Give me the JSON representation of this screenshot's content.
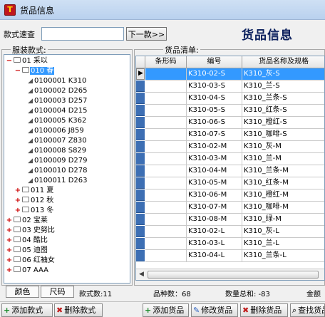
{
  "window": {
    "title": "货品信息",
    "icon": "app-logo-icon"
  },
  "search": {
    "label": "款式速查",
    "value": "",
    "next_label": "下一款>>"
  },
  "header": {
    "title": "货品信息"
  },
  "tree_panel": {
    "legend": "服装款式:"
  },
  "grid_panel": {
    "legend": "货品清单:"
  },
  "tree": [
    {
      "label": "01 采以",
      "expander": "−",
      "kind": "folder",
      "level": 0,
      "selected": false
    },
    {
      "label": "010 春",
      "expander": "−",
      "kind": "folder",
      "level": 1,
      "selected": true
    },
    {
      "label": "0100001 K310",
      "expander": "",
      "kind": "leaf",
      "level": 2,
      "selected": false
    },
    {
      "label": "0100002 D265",
      "expander": "",
      "kind": "leaf",
      "level": 2,
      "selected": false
    },
    {
      "label": "0100003 D257",
      "expander": "",
      "kind": "leaf",
      "level": 2,
      "selected": false
    },
    {
      "label": "0100004 D215",
      "expander": "",
      "kind": "leaf",
      "level": 2,
      "selected": false
    },
    {
      "label": "0100005 K362",
      "expander": "",
      "kind": "leaf",
      "level": 2,
      "selected": false
    },
    {
      "label": "0100006 J859",
      "expander": "",
      "kind": "leaf",
      "level": 2,
      "selected": false
    },
    {
      "label": "0100007 Z830",
      "expander": "",
      "kind": "leaf",
      "level": 2,
      "selected": false
    },
    {
      "label": "0100008 S829",
      "expander": "",
      "kind": "leaf",
      "level": 2,
      "selected": false
    },
    {
      "label": "0100009 D279",
      "expander": "",
      "kind": "leaf",
      "level": 2,
      "selected": false
    },
    {
      "label": "0100010 D278",
      "expander": "",
      "kind": "leaf",
      "level": 2,
      "selected": false
    },
    {
      "label": "0100011 D263",
      "expander": "",
      "kind": "leaf",
      "level": 2,
      "selected": false
    },
    {
      "label": "011 夏",
      "expander": "+",
      "kind": "folder",
      "level": 1,
      "selected": false
    },
    {
      "label": "012 秋",
      "expander": "+",
      "kind": "folder",
      "level": 1,
      "selected": false
    },
    {
      "label": "013 冬",
      "expander": "+",
      "kind": "folder",
      "level": 1,
      "selected": false
    },
    {
      "label": "02 宝莱",
      "expander": "+",
      "kind": "folder",
      "level": 0,
      "selected": false
    },
    {
      "label": "03 史努比",
      "expander": "+",
      "kind": "folder",
      "level": 0,
      "selected": false
    },
    {
      "label": "04 酷比",
      "expander": "+",
      "kind": "folder",
      "level": 0,
      "selected": false
    },
    {
      "label": "05 迪图",
      "expander": "+",
      "kind": "folder",
      "level": 0,
      "selected": false
    },
    {
      "label": "06 红袖女",
      "expander": "+",
      "kind": "folder",
      "level": 0,
      "selected": false
    },
    {
      "label": "07 AAA",
      "expander": "+",
      "kind": "folder",
      "level": 0,
      "selected": false
    }
  ],
  "grid": {
    "columns": [
      "条形码",
      "编号",
      "货品名称及规格"
    ],
    "rows": [
      {
        "barcode": "",
        "code": "K310-02-S",
        "name": "K310_灰-S",
        "selected": true,
        "current": true
      },
      {
        "barcode": "",
        "code": "K310-03-S",
        "name": "K310_兰-S",
        "selected": false,
        "current": false
      },
      {
        "barcode": "",
        "code": "K310-04-S",
        "name": "K310_兰条-S",
        "selected": false,
        "current": false
      },
      {
        "barcode": "",
        "code": "K310-05-S",
        "name": "K310_红条-S",
        "selected": false,
        "current": false
      },
      {
        "barcode": "",
        "code": "K310-06-S",
        "name": "K310_橙红-S",
        "selected": false,
        "current": false
      },
      {
        "barcode": "",
        "code": "K310-07-S",
        "name": "K310_咖啡-S",
        "selected": false,
        "current": false
      },
      {
        "barcode": "",
        "code": "K310-02-M",
        "name": "K310_灰-M",
        "selected": false,
        "current": false
      },
      {
        "barcode": "",
        "code": "K310-03-M",
        "name": "K310_兰-M",
        "selected": false,
        "current": false
      },
      {
        "barcode": "",
        "code": "K310-04-M",
        "name": "K310_兰条-M",
        "selected": false,
        "current": false
      },
      {
        "barcode": "",
        "code": "K310-05-M",
        "name": "K310_红条-M",
        "selected": false,
        "current": false
      },
      {
        "barcode": "",
        "code": "K310-06-M",
        "name": "K310_橙红-M",
        "selected": false,
        "current": false
      },
      {
        "barcode": "",
        "code": "K310-07-M",
        "name": "K310_咖啡-M",
        "selected": false,
        "current": false
      },
      {
        "barcode": "",
        "code": "K310-08-M",
        "name": "K310_绿-M",
        "selected": false,
        "current": false
      },
      {
        "barcode": "",
        "code": "K310-02-L",
        "name": "K310_灰-L",
        "selected": false,
        "current": false
      },
      {
        "barcode": "",
        "code": "K310-03-L",
        "name": "K310_兰-L",
        "selected": false,
        "current": false
      },
      {
        "barcode": "",
        "code": "K310-04-L",
        "name": "K310_兰条-L",
        "selected": false,
        "current": false
      }
    ]
  },
  "tabs": [
    "颜色",
    "尺码"
  ],
  "status": {
    "style_count": "款式数:11",
    "variety_count": "品种数：68",
    "quantity_total": "数量总和: -83",
    "amount": "金额"
  },
  "toolbar": {
    "add_style": "添加款式",
    "delete_style": "删除款式",
    "add_goods": "添加货品",
    "edit_goods": "修改货品",
    "delete_goods": "删除货品",
    "find_goods": "查找货品"
  },
  "colors": {
    "selection": "#3399ff",
    "row_indicator": "#3d6fb4",
    "title_text": "#0a1f5c"
  }
}
